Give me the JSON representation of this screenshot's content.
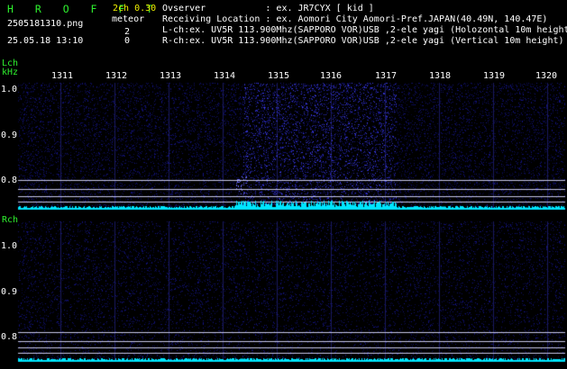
{
  "header": {
    "title": "H R O F F T",
    "channel_mode": "2ch 0.30",
    "meteor_label": "meteor",
    "filename": "2505181310.png",
    "datetime": "25.05.18 13:10",
    "meteor_count_l": "2",
    "meteor_count_r": "0",
    "info_lines": [
      "Ovserver           : ex. JR7CYX [ kid ]",
      "Receiving Location : ex. Aomori City Aomori-Pref.JAPAN(40.49N, 140.47E)",
      "L-ch:ex. UV5R 113.900Mhz(SAPPORO VOR)USB ,2-ele yagi (Holozontal 10m height)",
      "R-ch:ex. UV5R 113.900Mhz(SAPPORO VOR)USB ,2-ele yagi (Vertical 10m height)"
    ]
  },
  "lch": {
    "label": "Lch",
    "unit": "kHz",
    "y_ticks": [
      "1.0",
      "0.9",
      "0.8"
    ]
  },
  "rch": {
    "label": "Rch",
    "y_ticks": [
      "1.0",
      "0.9",
      "0.8"
    ]
  },
  "time_axis": {
    "labels": [
      "1311",
      "1312",
      "1313",
      "1314",
      "1315",
      "1316",
      "1317",
      "1318",
      "1319",
      "1320"
    ]
  },
  "colors": {
    "background": "#000000",
    "noise": "#0a0a6e",
    "signal": "#2a2aff",
    "trace": "#00e5ff",
    "title": "#2ef02e",
    "text": "#ffffff"
  }
}
